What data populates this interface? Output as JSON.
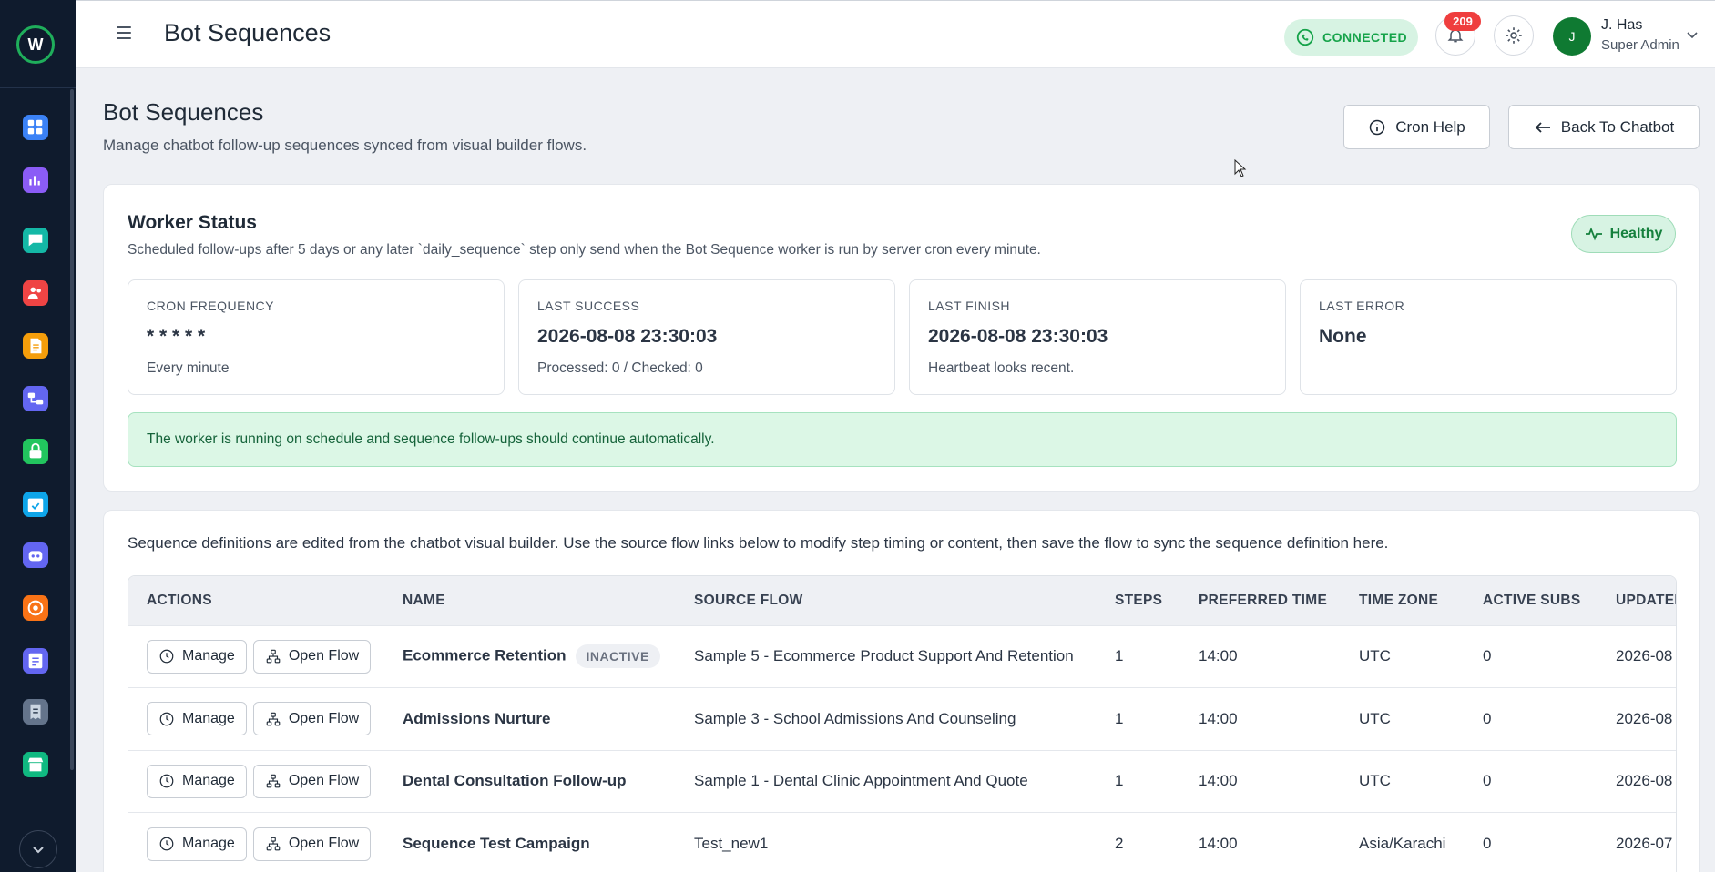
{
  "app": {
    "logo_letter": "W",
    "colors": {
      "accent_green": "#16a34a",
      "sidebar_bg": "#0f1b2d",
      "badge_red": "#ef3e3e"
    }
  },
  "sidebar": {
    "items": [
      {
        "icon": "dashboard-icon",
        "color": "#3b82f6"
      },
      {
        "icon": "analytics-icon",
        "color": "#8b5cf6"
      },
      {
        "icon": "chat-icon",
        "color": "#14b8a6"
      },
      {
        "icon": "contacts-icon",
        "color": "#ef4444"
      },
      {
        "icon": "templates-icon",
        "color": "#f59e0b"
      },
      {
        "icon": "flows-icon",
        "color": "#6366f1"
      },
      {
        "icon": "security-icon",
        "color": "#22c55e"
      },
      {
        "icon": "calendar-icon",
        "color": "#0ea5e9"
      },
      {
        "icon": "bot-icon",
        "color": "#6366f1"
      },
      {
        "icon": "campaign-icon",
        "color": "#f97316"
      },
      {
        "icon": "forms-icon",
        "color": "#6366f1"
      },
      {
        "icon": "invoice-icon",
        "color": "#64748b"
      },
      {
        "icon": "store-icon",
        "color": "#10b981"
      }
    ]
  },
  "topbar": {
    "title": "Bot Sequences",
    "connection_status": "CONNECTED",
    "notifications_count": "209",
    "user": {
      "initial": "J",
      "name": "J. Has",
      "role": "Super Admin"
    }
  },
  "page": {
    "title": "Bot Sequences",
    "subtitle": "Manage chatbot follow-up sequences synced from visual builder flows.",
    "cron_help_label": "Cron Help",
    "back_label": "Back To Chatbot"
  },
  "worker": {
    "title": "Worker Status",
    "subtitle": "Scheduled follow-ups after 5 days or any later `daily_sequence` step only send when the Bot Sequence worker is run by server cron every minute.",
    "health": "Healthy",
    "stats": [
      {
        "label": "CRON FREQUENCY",
        "value": "* * * * *",
        "note": "Every minute"
      },
      {
        "label": "LAST SUCCESS",
        "value": "2026-08-08 23:30:03",
        "note": "Processed: 0 / Checked: 0"
      },
      {
        "label": "LAST FINISH",
        "value": "2026-08-08 23:30:03",
        "note": "Heartbeat looks recent."
      },
      {
        "label": "LAST ERROR",
        "value": "None",
        "note": ""
      }
    ],
    "alert": "The worker is running on schedule and sequence follow-ups should continue automatically."
  },
  "sequences": {
    "note": "Sequence definitions are edited from the chatbot visual builder. Use the source flow links below to modify step timing or content, then save the flow to sync the sequence definition here.",
    "columns": [
      "ACTIONS",
      "NAME",
      "SOURCE FLOW",
      "STEPS",
      "PREFERRED TIME",
      "TIME ZONE",
      "ACTIVE SUBS",
      "UPDATED"
    ],
    "manage_label": "Manage",
    "open_flow_label": "Open Flow",
    "rows": [
      {
        "name": "Ecommerce Retention",
        "status": "INACTIVE",
        "source_flow": "Sample 5 - Ecommerce Product Support And Retention",
        "steps": "1",
        "time": "14:00",
        "zone": "UTC",
        "subs": "0",
        "updated": "2026-08"
      },
      {
        "name": "Admissions Nurture",
        "status": "",
        "source_flow": "Sample 3 - School Admissions And Counseling",
        "steps": "1",
        "time": "14:00",
        "zone": "UTC",
        "subs": "0",
        "updated": "2026-08"
      },
      {
        "name": "Dental Consultation Follow-up",
        "status": "",
        "source_flow": "Sample 1 - Dental Clinic Appointment And Quote",
        "steps": "1",
        "time": "14:00",
        "zone": "UTC",
        "subs": "0",
        "updated": "2026-08"
      },
      {
        "name": "Sequence Test Campaign",
        "status": "",
        "source_flow": "Test_new1",
        "steps": "2",
        "time": "14:00",
        "zone": "Asia/Karachi",
        "subs": "0",
        "updated": "2026-07"
      }
    ]
  }
}
